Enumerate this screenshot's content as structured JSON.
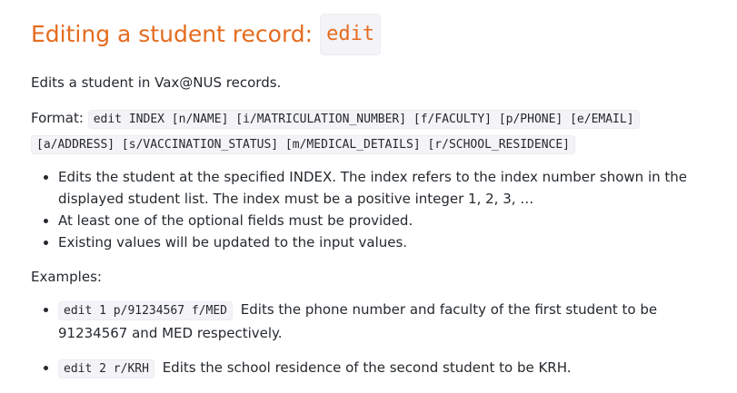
{
  "heading": {
    "text": "Editing a student record:",
    "command": "edit"
  },
  "description": "Edits a student in Vax@NUS records.",
  "format": {
    "label": "Format:",
    "line1": "edit INDEX [n/NAME] [i/MATRICULATION_NUMBER] [f/FACULTY] [p/PHONE] [e/EMAIL]",
    "line2": "[a/ADDRESS] [s/VACCINATION_STATUS] [m/MEDICAL_DETAILS] [r/SCHOOL_RESIDENCE]"
  },
  "notes": [
    "Edits the student at the specified INDEX. The index refers to the index number shown in the displayed student list. The index must be a positive integer 1, 2, 3, …",
    "At least one of the optional fields must be provided.",
    "Existing values will be updated to the input values."
  ],
  "examples_label": "Examples:",
  "examples": [
    {
      "code": "edit 1 p/91234567 f/MED",
      "text": "Edits the phone number and faculty of the first student to be 91234567 and MED respectively."
    },
    {
      "code": "edit 2 r/KRH",
      "text": "Edits the school residence of the second student to be KRH."
    }
  ],
  "colors": {
    "heading": "#e46c1f",
    "code_background": "#f4f3f7",
    "text": "#24292e"
  }
}
